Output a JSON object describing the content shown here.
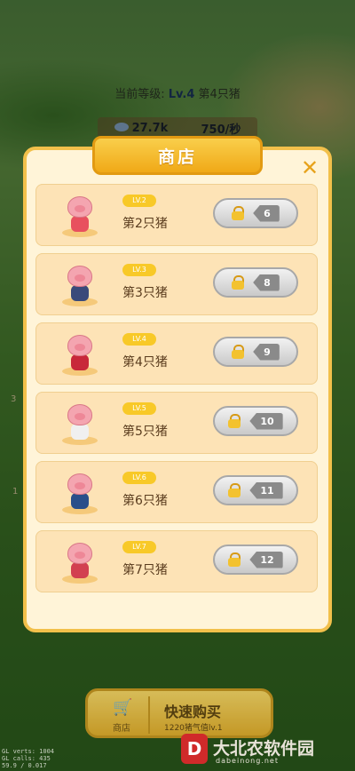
{
  "hud": {
    "level_label": "当前等级: ",
    "level_value": "Lv.4",
    "level_pig": " 第4只猪",
    "coins": "27.7k",
    "rate": "750/秒"
  },
  "side_numbers": [
    "3",
    "1"
  ],
  "debug_lines": [
    "GL verts: 1004",
    "GL calls: 435",
    "59.9 / 0.017"
  ],
  "shop": {
    "title": "商店",
    "close": "✕",
    "items": [
      {
        "level": "LV.2",
        "name": "第2只猪",
        "price": "6",
        "body_color": "#e8505e"
      },
      {
        "level": "LV.3",
        "name": "第3只猪",
        "price": "8",
        "body_color": "#3a4a7a"
      },
      {
        "level": "LV.4",
        "name": "第4只猪",
        "price": "9",
        "body_color": "#c8283a"
      },
      {
        "level": "LV.5",
        "name": "第5只猪",
        "price": "10",
        "body_color": "#f0f0f0"
      },
      {
        "level": "LV.6",
        "name": "第6只猪",
        "price": "11",
        "body_color": "#2a4f8a"
      },
      {
        "level": "LV.7",
        "name": "第7只猪",
        "price": "12",
        "body_color": "#d24050"
      }
    ]
  },
  "quick_buy": {
    "cart_label": "商店",
    "label": "快速购买",
    "sub": "1220猪气值lv.1"
  },
  "watermark": {
    "logo": "D",
    "text": "大北农软件园",
    "url": "dabeinong.net"
  }
}
